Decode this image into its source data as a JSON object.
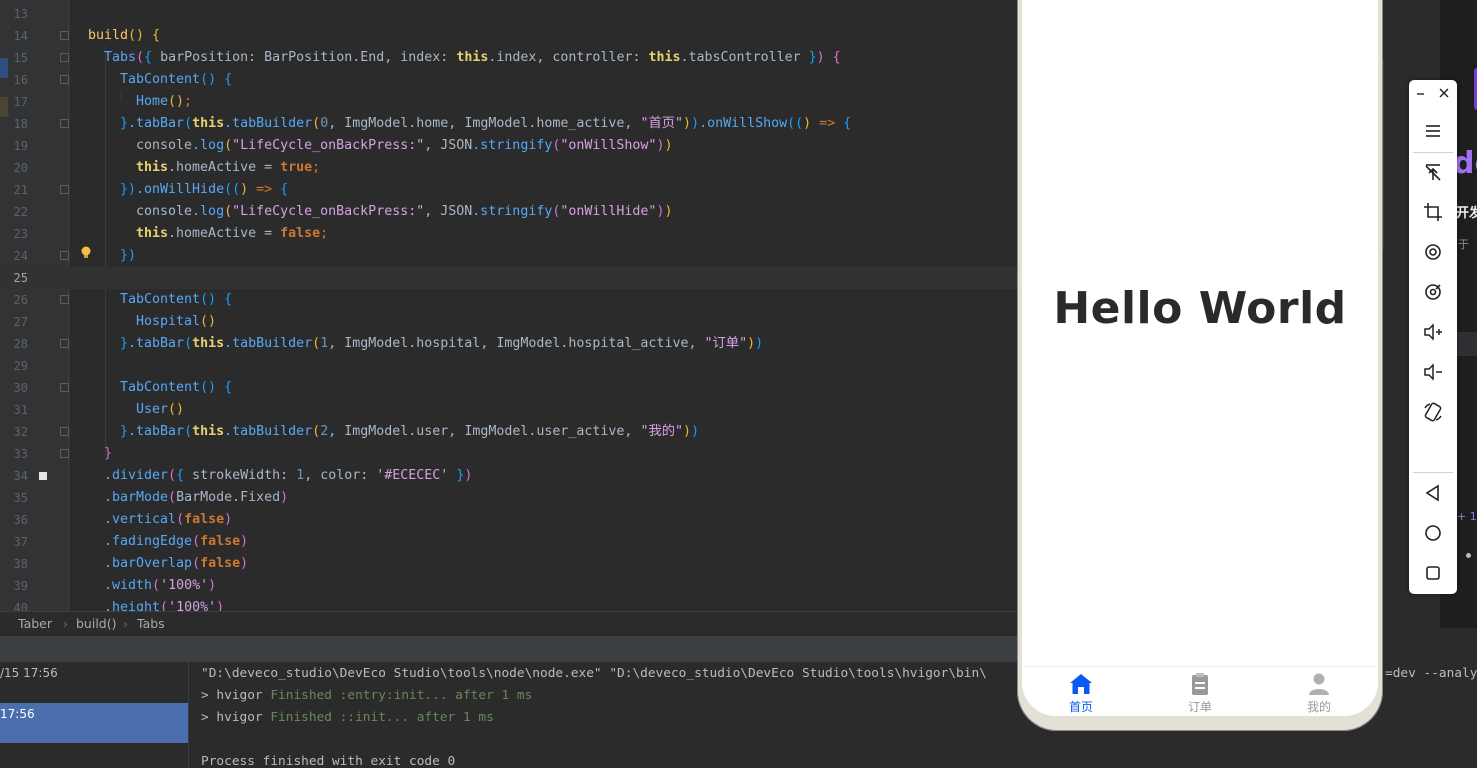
{
  "editor": {
    "lines": [
      {
        "n": "13"
      },
      {
        "n": "14"
      },
      {
        "n": "15"
      },
      {
        "n": "16"
      },
      {
        "n": "17"
      },
      {
        "n": "18"
      },
      {
        "n": "19"
      },
      {
        "n": "20"
      },
      {
        "n": "21"
      },
      {
        "n": "22"
      },
      {
        "n": "23"
      },
      {
        "n": "24"
      },
      {
        "n": "25"
      },
      {
        "n": "26"
      },
      {
        "n": "27"
      },
      {
        "n": "28"
      },
      {
        "n": "29"
      },
      {
        "n": "30"
      },
      {
        "n": "31"
      },
      {
        "n": "32"
      },
      {
        "n": "33"
      },
      {
        "n": "34"
      },
      {
        "n": "35"
      },
      {
        "n": "36"
      },
      {
        "n": "37"
      },
      {
        "n": "38"
      },
      {
        "n": "39"
      },
      {
        "n": "40"
      }
    ],
    "code": {
      "l14": "build",
      "l15_tabs": "Tabs",
      "l15_bp": "barPosition",
      "l15_bpv": "BarPosition.End",
      "l15_index": "index",
      "l15_this": "this",
      "l15_indexv": ".index",
      "l15_ctrl": "controller",
      "l15_ctrlv": ".tabsController",
      "tabcontent": "TabContent",
      "l17": "Home",
      "tabbar": ".tabBar",
      "this": "this",
      "tabbuilder": ".tabBuilder",
      "l18_n": "0",
      "l18_a": "ImgModel.home",
      "l18_b": "ImgModel.home_active",
      "l18_s": "\"首页\"",
      "l18_show": ".onWillShow",
      "console": "console",
      "log": ".log",
      "lifecycle": "\"LifeCycle_onBackPress:\"",
      "json": "JSON",
      "stringify": ".stringify",
      "l19_s": "\"onWillShow\"",
      "homeactive": ".homeActive",
      "true": "true",
      "false": "false",
      "l21_hide": ".onWillHide",
      "l22_s": "\"onWillHide\"",
      "l27": "Hospital",
      "l28_n": "1",
      "l28_a": "ImgModel.hospital",
      "l28_b": "ImgModel.hospital_active",
      "l28_s": "\"订单\"",
      "l31": "User",
      "l32_n": "2",
      "l32_a": "ImgModel.user",
      "l32_b": "ImgModel.user_active",
      "l32_s": "\"我的\"",
      "divider": ".divider",
      "strokewidth": "strokeWidth",
      "one": "1",
      "color": "color",
      "colorv": "'#ECECEC'",
      "barmode": ".barMode",
      "barmodev": "BarMode.Fixed",
      "vertical": ".vertical",
      "fading": ".fadingEdge",
      "overlap": ".barOverlap",
      "width": ".width",
      "height": ".height",
      "pct": "'100%'"
    }
  },
  "breadcrumb": {
    "items": [
      "Taber",
      "build()",
      "Tabs"
    ],
    "sep": "›"
  },
  "run": {
    "items": [
      {
        "label": "/15 17:56"
      },
      {
        "label": "17:56"
      }
    ]
  },
  "console": {
    "line1": "\"D:\\deveco_studio\\DevEco Studio\\tools\\node\\node.exe\" \"D:\\deveco_studio\\DevEco Studio\\tools\\hvigor\\bin\\",
    "line1_tail": "=dev --analy",
    "line2_prefix": "> hvigor ",
    "line2_msg": "Finished :entry:init... after 1 ms",
    "line3_prefix": "> hvigor ",
    "line3_msg": "Finished ::init... after 1 ms",
    "line5": "Process finished with exit code 0"
  },
  "phone": {
    "hello": "Hello World",
    "tabs": [
      {
        "label": "首页",
        "icon": "home-icon",
        "active": true
      },
      {
        "label": "订单",
        "icon": "clipboard-icon",
        "active": false
      },
      {
        "label": "我的",
        "icon": "user-icon",
        "active": false
      }
    ],
    "active_color": "#0A59F7",
    "inactive_color": "#999999"
  },
  "right_panel": {
    "t1": "de",
    "t2": "开发",
    "t3": "于",
    "t4": "+ 1"
  },
  "colors": {
    "accent_blue": "#4b6eaf",
    "editor_bg": "#2b2b2b"
  }
}
